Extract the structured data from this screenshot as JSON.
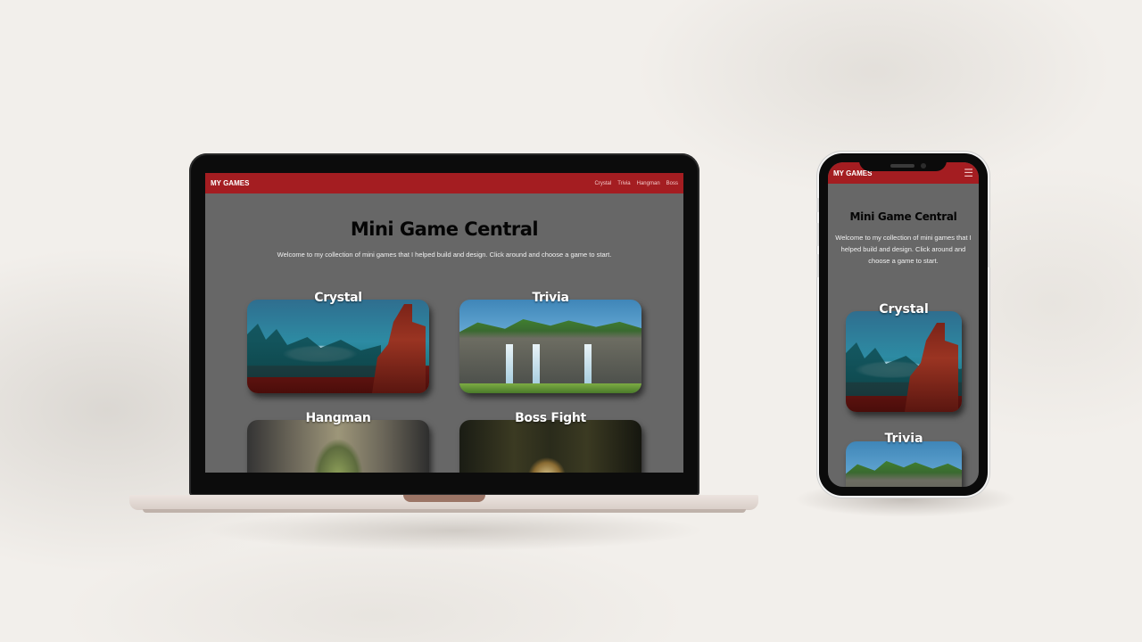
{
  "laptop": {
    "nav": {
      "brand": "MY GAMES",
      "links": [
        "Crystal",
        "Trivia",
        "Hangman",
        "Boss"
      ]
    },
    "hero": {
      "title": "Mini Game Central",
      "text": "Welcome to my collection of mini games that I helped build and design. Click around and choose a game to start."
    },
    "cards": [
      {
        "label": "Crystal"
      },
      {
        "label": "Trivia"
      },
      {
        "label": "Hangman"
      },
      {
        "label": "Boss Fight"
      }
    ]
  },
  "phone": {
    "nav": {
      "brand": "MY GAMES",
      "menu_icon": "hamburger-menu-icon"
    },
    "hero": {
      "title": "Mini Game Central",
      "text": "Welcome to my collection of mini games that I helped build and design. Click around and choose a game to start."
    },
    "cards": [
      {
        "label": "Crystal"
      },
      {
        "label": "Trivia"
      }
    ]
  },
  "colors": {
    "background": "#f2efeb",
    "nav": "#a41d21",
    "page": "#676767"
  }
}
